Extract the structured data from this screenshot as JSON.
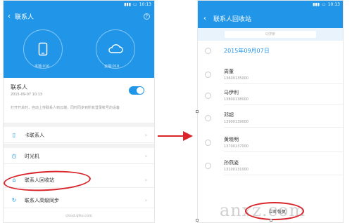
{
  "left": {
    "status": {
      "time": "10:13"
    },
    "title": "联系人",
    "help_icon": "?",
    "local_label": "本地:010",
    "cloud_label": "云端:010",
    "contact_name": "联系人",
    "contact_date": "2015-09-07 10:13",
    "description": "打开开关时，自动上传联系人到云端，同时同步到所有登录帐号的设备",
    "menu": [
      {
        "icon": "sim-card-icon",
        "label": "卡联系人"
      },
      {
        "icon": "clock-icon",
        "label": "时光机"
      },
      {
        "icon": "trash-icon",
        "label": "联系人回收站"
      },
      {
        "icon": "sync-icon",
        "label": "联系人高级同步"
      }
    ],
    "footer": "cloud.qiku.com"
  },
  "right": {
    "status": {
      "time": "10:13"
    },
    "title": "联系人回收站",
    "search_placeholder": "Q搜索",
    "date": "2015年09月07日",
    "items": [
      {
        "name": "周董",
        "phone": "13600135000"
      },
      {
        "name": "马伊利",
        "phone": "13800138000"
      },
      {
        "name": "邓超",
        "phone": "13900139000"
      },
      {
        "name": "黄晓明",
        "phone": "13700137000"
      },
      {
        "name": "孙燕姿",
        "phone": "13100131000"
      }
    ],
    "restore_button": "立即恢复"
  },
  "watermark": "anxz.com",
  "colors": {
    "accent": "#2196e8",
    "highlight": "#d8242a"
  }
}
